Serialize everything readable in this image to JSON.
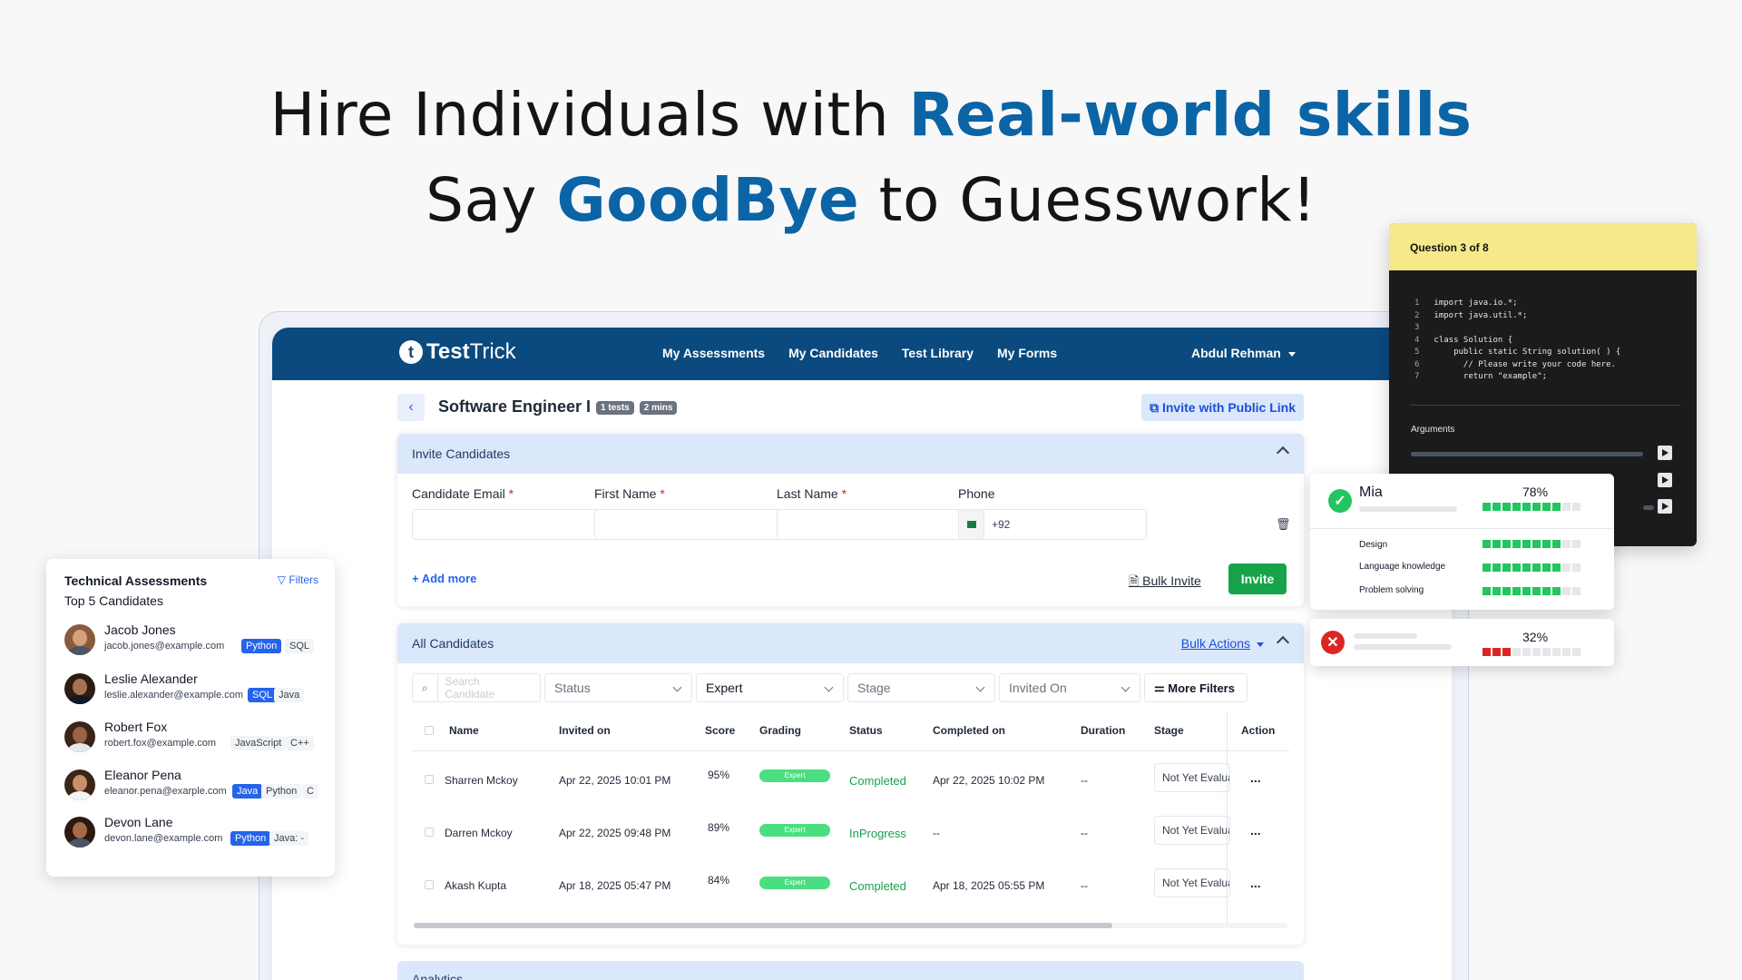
{
  "hero": {
    "line1_pre": "Hire Individuals with ",
    "line1_highlight": "Real-world skills",
    "line2_pre": "Say ",
    "line2_highlight": "GoodBye",
    "line2_post": " to Guesswork!",
    "accent_color": "#0b64a5"
  },
  "app": {
    "logo_icon": "t",
    "logo_bold": "Test",
    "logo_rest": "Trick",
    "nav": [
      "My Assessments",
      "My Candidates",
      "Test Library",
      "My Forms"
    ],
    "user": "Abdul Rehman",
    "brand_color": "#0a4a7e"
  },
  "page": {
    "title": "Software Engineer I",
    "pill_tests": "1 tests",
    "pill_time": "2 mins",
    "public_link": "Invite with Public Link"
  },
  "invite": {
    "header": "Invite Candidates",
    "email_label": "Candidate Email",
    "first_label": "First Name",
    "last_label": "Last Name",
    "phone_label": "Phone",
    "phone_code": "+92",
    "add_more": "+ Add more",
    "bulk_invite": "Bulk Invite",
    "invite_btn": "Invite",
    "required_mark": "*"
  },
  "candidates": {
    "header": "All Candidates",
    "bulk_actions": "Bulk Actions",
    "search_placeholder": "Search Candidate",
    "filters": [
      "Status",
      "Expert",
      "Stage",
      "Invited On"
    ],
    "more_filters": "More Filters",
    "columns": [
      "Name",
      "Invited on",
      "Score",
      "Grading",
      "Status",
      "Completed on",
      "Duration",
      "Stage",
      "Action"
    ],
    "rows": [
      {
        "name": "Sharren Mckoy",
        "invited": "Apr 22, 2025 10:01 PM",
        "score": "95%",
        "grading": "Expert",
        "status": "Completed",
        "completed": "Apr 22, 2025 10:02 PM",
        "duration": "--",
        "stage": "Not Yet Evaluated",
        "action": "..."
      },
      {
        "name": "Darren Mckoy",
        "invited": "Apr 22, 2025 09:48 PM",
        "score": "89%",
        "grading": "Expert",
        "status": "InProgress",
        "completed": "--",
        "duration": "--",
        "stage": "Not Yet Evaluated",
        "action": "..."
      },
      {
        "name": "Akash Kupta",
        "invited": "Apr 18, 2025 05:47 PM",
        "score": "84%",
        "grading": "Expert",
        "status": "Completed",
        "completed": "Apr 18, 2025 05:55 PM",
        "duration": "--",
        "stage": "Not Yet Evaluated",
        "action": "..."
      }
    ],
    "analytics": "Analytics"
  },
  "leftcard": {
    "title": "Technical Assessments",
    "subtitle": "Top 5 Candidates",
    "filters": "Filters",
    "people": [
      {
        "name": "Jacob Jones",
        "email": "jacob.jones@example.com",
        "tags": [
          "Python",
          "SQL"
        ]
      },
      {
        "name": "Leslie Alexander",
        "email": "leslie.alexander@example.com",
        "tags": [
          "SQL",
          "Java"
        ]
      },
      {
        "name": "Robert Fox",
        "email": "robert.fox@example.com",
        "tags": [
          "JavaScript",
          "C++"
        ]
      },
      {
        "name": "Eleanor Pena",
        "email": "eleanor.pena@exarple.com",
        "tags": [
          "Java",
          "Python",
          "C"
        ]
      },
      {
        "name": "Devon Lane",
        "email": "devon.lane@example.com",
        "tags": [
          "Python",
          "Java: -"
        ]
      }
    ]
  },
  "code": {
    "header": "Question 3 of 8",
    "lines": [
      {
        "n": "1",
        "t": "import java.io.*;"
      },
      {
        "n": "2",
        "t": "import java.util.*;"
      },
      {
        "n": "3",
        "t": ""
      },
      {
        "n": "4",
        "t": "class Solution {"
      },
      {
        "n": "5",
        "t": "    public static String solution( ) {"
      },
      {
        "n": "6",
        "t": "      // Please write your code here."
      },
      {
        "n": "7",
        "t": "      return \"example\";"
      }
    ],
    "arguments": "Arguments"
  },
  "score_pass": {
    "name": "Mia",
    "percent": "78%",
    "overall_fill": 8,
    "skills": [
      {
        "label": "Design",
        "fill": 8
      },
      {
        "label": "Language knowledge",
        "fill": 8
      },
      {
        "label": "Problem solving",
        "fill": 8
      }
    ],
    "segments_total": 10
  },
  "score_fail": {
    "percent": "32%",
    "fill": 3,
    "segments_total": 10
  }
}
